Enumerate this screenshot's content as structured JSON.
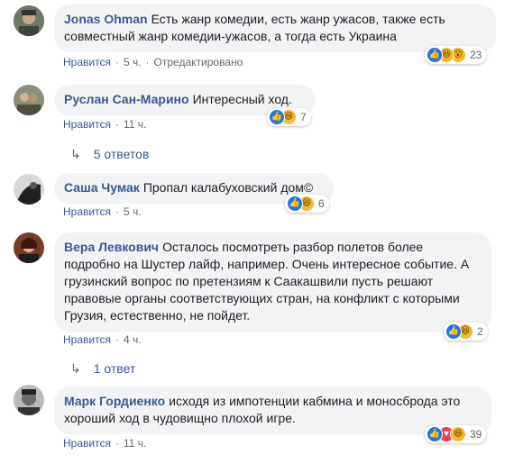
{
  "comments": [
    {
      "author": "Jonas Ohman",
      "text": "Есть жанр комедии, есть жанр ужасов, также есть совместный жанр комедии-ужасов, а тогда есть Украина",
      "like_label": "Нравится",
      "time": "5 ч.",
      "edited": "Отредактировано",
      "reaction_count": "23"
    },
    {
      "author": "Руслан Сан-Марино",
      "text": "Интересный ход.",
      "like_label": "Нравится",
      "time": "11 ч.",
      "reaction_count": "7",
      "replies": "5 ответов"
    },
    {
      "author": "Саша Чумак",
      "text": "Пропал калабуховский дом©",
      "like_label": "Нравится",
      "time": "5 ч.",
      "reaction_count": "6"
    },
    {
      "author": "Вера Левкович",
      "text": "Осталось посмотреть разбор полетов более подробно на Шустер лайф, например. Очень интересное событие. А грузинский вопрос по претензиям к Саакашвили пусть решают правовые органы соответствующих стран, на конфликт с которыми Грузия, естественно, не пойдет.",
      "like_label": "Нравится",
      "time": "4 ч.",
      "reaction_count": "2",
      "replies": "1 ответ"
    },
    {
      "author": "Марк Гордиенко",
      "text": "исходя из импотенции кабмина и моносброда это хороший ход в чудовищно плохой игре.",
      "like_label": "Нравится",
      "time": "11 ч.",
      "reaction_count": "39"
    }
  ],
  "reactions": {
    "like_icon": "👍",
    "haha_icon": "😆",
    "wow_icon": "😮",
    "love_icon": "♥"
  },
  "colors": {
    "link": "#385898",
    "bubble": "#f2f3f5",
    "meta": "#606770"
  }
}
